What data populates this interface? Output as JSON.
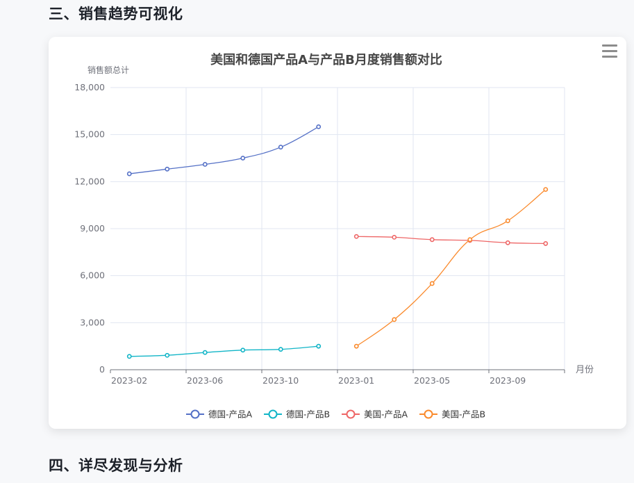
{
  "sections": {
    "trend_title": "三、销售趋势可视化",
    "findings_title": "四、详尽发现与分析"
  },
  "colors": {
    "germany_a": "#5470c6",
    "germany_b": "#11b5c7",
    "us_a": "#ee6666",
    "us_b": "#fa8a2c"
  },
  "chart_data": {
    "type": "line",
    "title": "美国和德国产品A与产品B月度销售额对比",
    "ylabel": "销售额总计",
    "xlabel": "月份",
    "ylim": [
      0,
      18000
    ],
    "yticks": [
      "0",
      "3,000",
      "6,000",
      "9,000",
      "12,000",
      "15,000",
      "18,000"
    ],
    "xticks_left": [
      "2023-02",
      "2023-06",
      "2023-10"
    ],
    "xticks_right": [
      "2023-01",
      "2023-05",
      "2023-09"
    ],
    "grid": true,
    "legend_position": "bottom",
    "series": [
      {
        "name": "德国-产品A",
        "segment": "left",
        "values": [
          12500,
          12800,
          13100,
          13500,
          14200,
          15500
        ]
      },
      {
        "name": "德国-产品B",
        "segment": "left",
        "values": [
          850,
          920,
          1100,
          1250,
          1300,
          1500
        ]
      },
      {
        "name": "美国-产品A",
        "segment": "right",
        "values": [
          8500,
          8450,
          8300,
          8250,
          8100,
          8050
        ]
      },
      {
        "name": "美国-产品B",
        "segment": "right",
        "values": [
          1500,
          3200,
          5500,
          8300,
          9500,
          11500
        ]
      }
    ]
  }
}
